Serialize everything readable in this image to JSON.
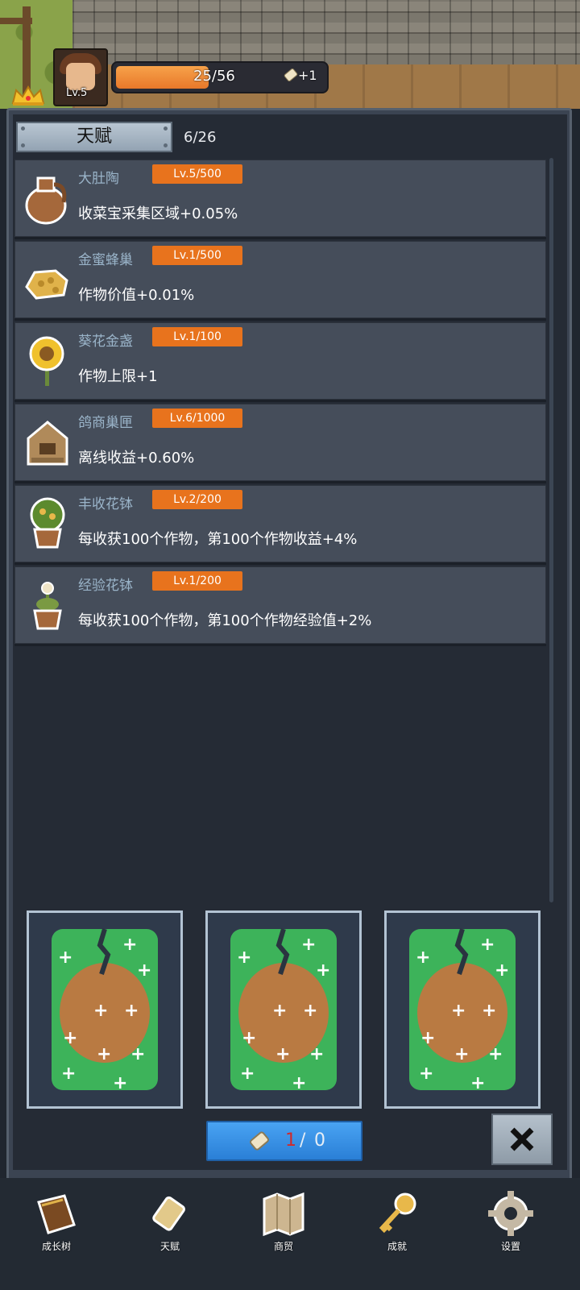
{
  "player": {
    "level": "Lv.5",
    "xp_text": "25/56",
    "xp_progress": 0.446,
    "scroll_bonus": "+1"
  },
  "talent_panel": {
    "title": "天赋",
    "count": "6/26"
  },
  "talents": [
    {
      "name": "大肚陶",
      "level": "Lv.5/500",
      "desc": "收菜宝采集区域+0.05%",
      "icon": "clay-jar-icon"
    },
    {
      "name": "金蜜蜂巢",
      "level": "Lv.1/500",
      "desc": "作物价值+0.01%",
      "icon": "honeycomb-icon"
    },
    {
      "name": "葵花金盏",
      "level": "Lv.1/100",
      "desc": "作物上限+1",
      "icon": "sunflower-icon"
    },
    {
      "name": "鸽商巢匣",
      "level": "Lv.6/1000",
      "desc": "离线收益+0.60%",
      "icon": "pigeon-box-icon"
    },
    {
      "name": "丰收花钵",
      "level": "Lv.2/200",
      "desc": "每收获100个作物，第100个作物收益+4%",
      "icon": "harvest-flowerpot-icon"
    },
    {
      "name": "经验花钵",
      "level": "Lv.1/200",
      "desc": "每收获100个作物，第100个作物经验值+2%",
      "icon": "exp-flowerpot-icon"
    }
  ],
  "draw_button": {
    "current": "1",
    "separator": "/",
    "total": "0"
  },
  "nav": [
    {
      "label": "成长树",
      "icon": "book-icon"
    },
    {
      "label": "天赋",
      "icon": "scroll-icon"
    },
    {
      "label": "商贸",
      "icon": "map-icon"
    },
    {
      "label": "成就",
      "icon": "key-icon"
    },
    {
      "label": "设置",
      "icon": "gear-icon"
    }
  ],
  "colors": {
    "level_badge": "#e8731d",
    "xp_fill": "#f28c3a",
    "button_blue": "#3a91e6",
    "panel_bg": "#252b35",
    "card_bg": "#454d5a"
  }
}
